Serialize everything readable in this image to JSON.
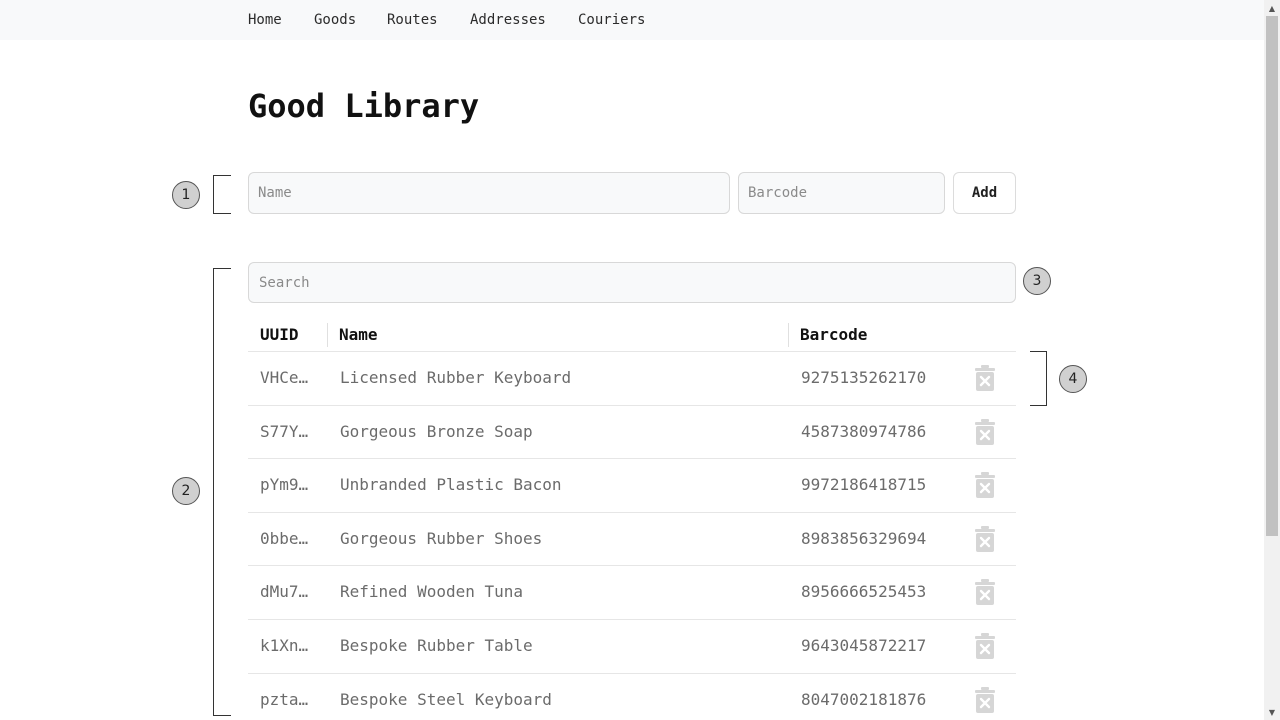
{
  "nav": {
    "items": [
      {
        "label": "Home"
      },
      {
        "label": "Goods"
      },
      {
        "label": "Routes"
      },
      {
        "label": "Addresses"
      },
      {
        "label": "Couriers"
      }
    ]
  },
  "page": {
    "title": "Good Library"
  },
  "add_form": {
    "name_placeholder": "Name",
    "name_value": "",
    "barcode_placeholder": "Barcode",
    "barcode_value": "",
    "add_label": "Add"
  },
  "search": {
    "placeholder": "Search",
    "value": ""
  },
  "table": {
    "headers": {
      "uuid": "UUID",
      "name": "Name",
      "barcode": "Barcode"
    },
    "rows": [
      {
        "uuid": "VHCe…",
        "name": "Licensed Rubber Keyboard",
        "barcode": "9275135262170"
      },
      {
        "uuid": "S77Y…",
        "name": "Gorgeous Bronze Soap",
        "barcode": "4587380974786"
      },
      {
        "uuid": "pYm9…",
        "name": "Unbranded Plastic Bacon",
        "barcode": "9972186418715"
      },
      {
        "uuid": "0bbe…",
        "name": "Gorgeous Rubber Shoes",
        "barcode": "8983856329694"
      },
      {
        "uuid": "dMu7…",
        "name": "Refined Wooden Tuna",
        "barcode": "8956666525453"
      },
      {
        "uuid": "k1Xn…",
        "name": "Bespoke Rubber Table",
        "barcode": "9643045872217"
      },
      {
        "uuid": "pzta…",
        "name": "Bespoke Steel Keyboard",
        "barcode": "8047002181876"
      }
    ],
    "row_action_icon": "trash-icon"
  },
  "annotations": [
    {
      "label": "1"
    },
    {
      "label": "2"
    },
    {
      "label": "3"
    },
    {
      "label": "4"
    }
  ],
  "colors": {
    "nav_bg": "#f8f9fa",
    "input_bg": "#f8f9fa",
    "text_muted": "#6b6b6b",
    "trash_icon": "#d6d6d6",
    "badge_bg": "#d0d0d0"
  }
}
